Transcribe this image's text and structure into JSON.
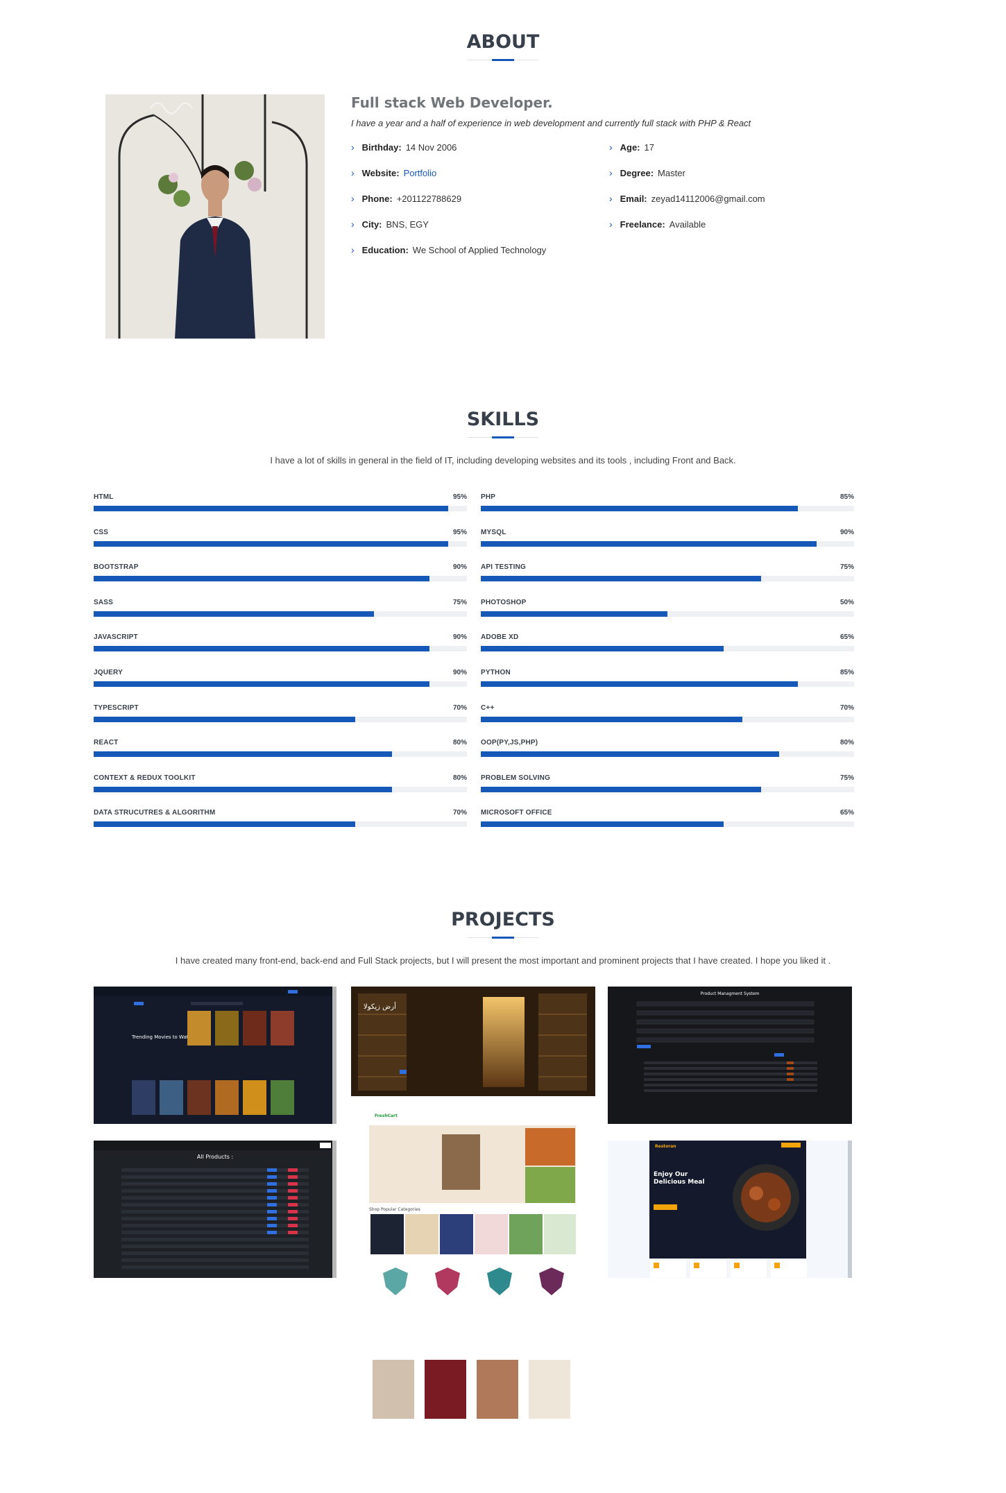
{
  "about": {
    "title": "ABOUT",
    "role": "Full stack Web Developer.",
    "lead": "I have a year and a half of experience in web development and currently full stack with PHP & React",
    "info": [
      {
        "label": "Birthday:",
        "value": "14 Nov 2006"
      },
      {
        "label": "Age:",
        "value": "17"
      },
      {
        "label": "Website:",
        "value": "Portfolio"
      },
      {
        "label": "Degree:",
        "value": "Master"
      },
      {
        "label": "Phone:",
        "value": "+201122788629"
      },
      {
        "label": "Email:",
        "value": "zeyad14112006@gmail.com"
      },
      {
        "label": "City:",
        "value": "BNS, EGY"
      },
      {
        "label": "Freelance:",
        "value": "Available"
      },
      {
        "label": "Education:",
        "value": "We School of Applied Technology"
      }
    ]
  },
  "skills": {
    "title": "SKILLS",
    "description": "I have a lot of skills in general in the field of IT, including developing websites and its tools , including Front and Back.",
    "left": [
      {
        "name": "HTML",
        "value": "95%",
        "pct": 95
      },
      {
        "name": "CSS",
        "value": "95%",
        "pct": 95
      },
      {
        "name": "BOOTSTRAP",
        "value": "90%",
        "pct": 90
      },
      {
        "name": "SASS",
        "value": "75%",
        "pct": 75
      },
      {
        "name": "JAVASCRIPT",
        "value": "90%",
        "pct": 90
      },
      {
        "name": "JQUERY",
        "value": "90%",
        "pct": 90
      },
      {
        "name": "TYPESCRIPT",
        "value": "70%",
        "pct": 70
      },
      {
        "name": "REACT",
        "value": "80%",
        "pct": 80
      },
      {
        "name": "CONTEXT & REDUX TOOLKIT",
        "value": "80%",
        "pct": 80
      },
      {
        "name": "DATA STRUCUTRES & ALGORITHM",
        "value": "70%",
        "pct": 70
      }
    ],
    "right": [
      {
        "name": "PHP",
        "value": "85%",
        "pct": 85
      },
      {
        "name": "MYSQL",
        "value": "90%",
        "pct": 90
      },
      {
        "name": "API TESTING",
        "value": "75%",
        "pct": 75
      },
      {
        "name": "PHOTOSHOP",
        "value": "50%",
        "pct": 50
      },
      {
        "name": "ADOBE XD",
        "value": "65%",
        "pct": 65
      },
      {
        "name": "PYTHON",
        "value": "85%",
        "pct": 85
      },
      {
        "name": "C++",
        "value": "70%",
        "pct": 70
      },
      {
        "name": "OOP(PY,JS,PHP)",
        "value": "80%",
        "pct": 80
      },
      {
        "name": "PROBLEM SOLVING",
        "value": "75%",
        "pct": 75
      },
      {
        "name": "MICROSOFT OFFICE",
        "value": "65%",
        "pct": 65
      }
    ]
  },
  "projects": {
    "title": "PROJECTS",
    "description": "I have created many front-end, back-end and Full Stack projects, but I will present the most important and prominent projects that I have created. I hope you liked it .",
    "items": [
      {
        "id": "movies",
        "heading": "Trending Movies to Watch now",
        "brand": "Noxe"
      },
      {
        "id": "quran",
        "heading": "أرض زيكولا",
        "brand": ""
      },
      {
        "id": "products",
        "heading": "Product Managment System",
        "brand": ""
      },
      {
        "id": "freshcart",
        "heading": "Shop Popular Categories",
        "brand": "FreshCart"
      },
      {
        "id": "allproducts",
        "heading": "All Products :",
        "brand": ""
      },
      {
        "id": "restaurant",
        "heading": "Enjoy Our Delicious Meal",
        "brand": "Restoran"
      }
    ]
  },
  "colors": {
    "accent": "#1558b8",
    "title": "#37404a",
    "track": "#eef0f3"
  }
}
